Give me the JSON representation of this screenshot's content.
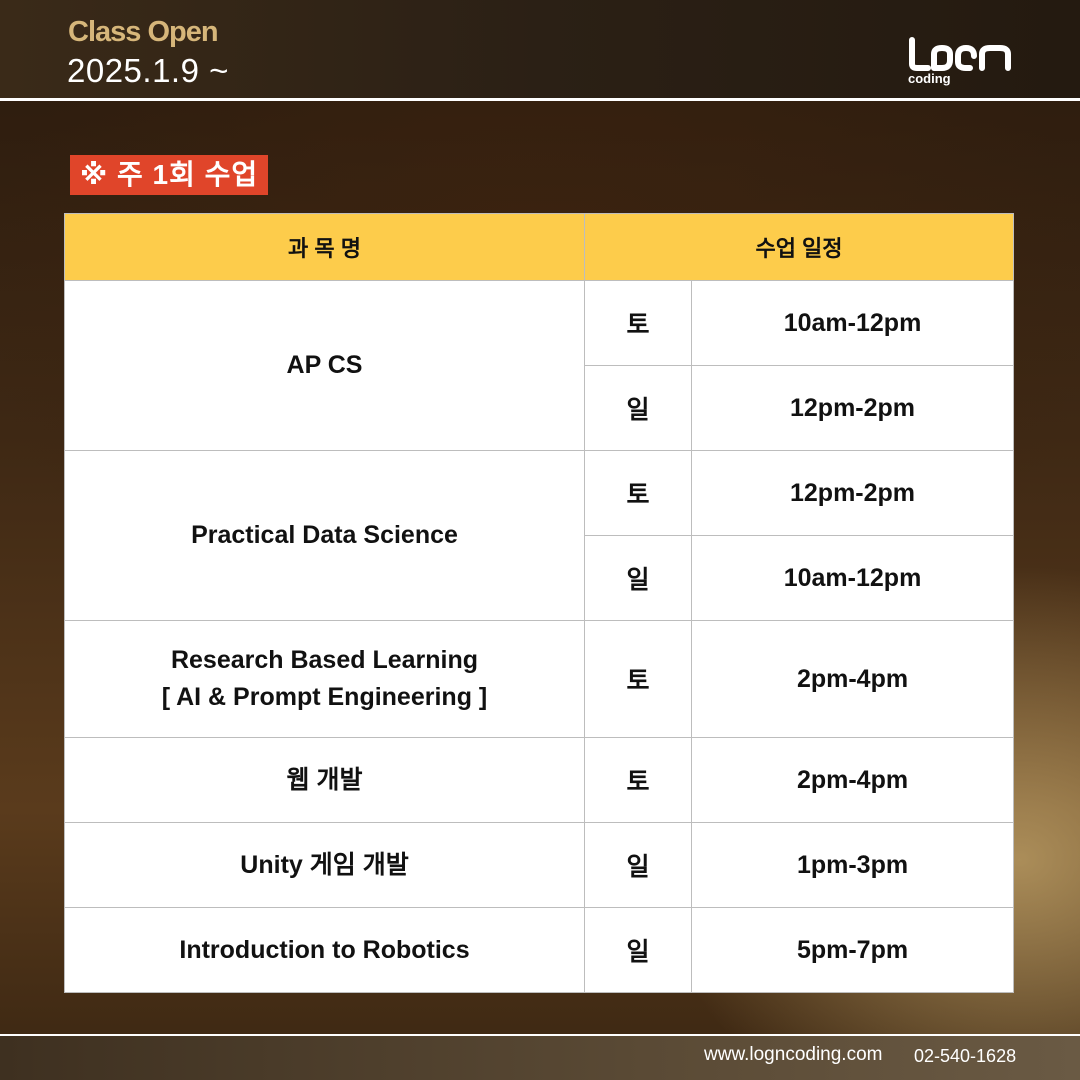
{
  "header": {
    "class_open": "Class Open",
    "date": "2025.1.9 ~",
    "logo_text": "logn",
    "logo_sub": "coding"
  },
  "badge": {
    "text": "※ 주 1회 수업"
  },
  "table": {
    "headers": {
      "course": "과 목 명",
      "schedule": "수업 일정"
    },
    "courses": [
      {
        "name": [
          "AP CS"
        ],
        "sessions": [
          {
            "day": "토",
            "time": "10am-12pm"
          },
          {
            "day": "일",
            "time": "12pm-2pm"
          }
        ]
      },
      {
        "name": [
          "Practical Data Science"
        ],
        "sessions": [
          {
            "day": "토",
            "time": "12pm-2pm"
          },
          {
            "day": "일",
            "time": "10am-12pm"
          }
        ]
      },
      {
        "name": [
          "Research Based Learning",
          "[ AI & Prompt Engineering ]"
        ],
        "sessions": [
          {
            "day": "토",
            "time": "2pm-4pm"
          }
        ]
      },
      {
        "name": [
          "웹 개발"
        ],
        "sessions": [
          {
            "day": "토",
            "time": "2pm-4pm"
          }
        ]
      },
      {
        "name": [
          "Unity 게임 개발"
        ],
        "sessions": [
          {
            "day": "일",
            "time": "1pm-3pm"
          }
        ]
      },
      {
        "name": [
          "Introduction to Robotics"
        ],
        "sessions": [
          {
            "day": "일",
            "time": "5pm-7pm"
          }
        ]
      }
    ]
  },
  "footer": {
    "website": "www.logncoding.com",
    "phone": "02-540-1628"
  },
  "colors": {
    "accent_badge": "#e0452a",
    "table_header": "#fdcc4b",
    "class_open": "#d6b67a"
  }
}
